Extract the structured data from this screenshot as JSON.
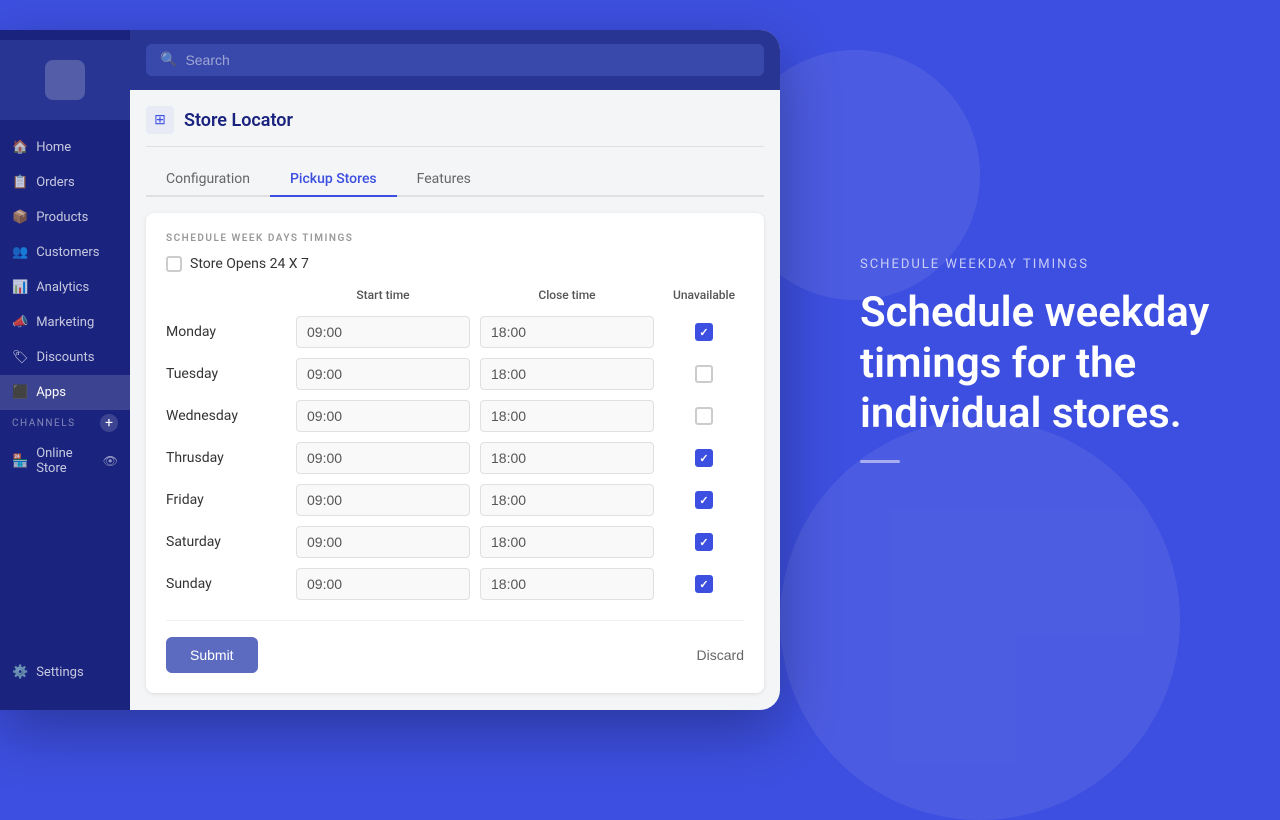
{
  "background": {
    "color": "#3d4fe0"
  },
  "right_panel": {
    "subtitle": "SCHEDULE WEEKDAY TIMINGS",
    "title": "Schedule weekday timings for the individual stores."
  },
  "sidebar": {
    "items": [
      {
        "id": "home",
        "label": "Home"
      },
      {
        "id": "orders",
        "label": "Orders"
      },
      {
        "id": "products",
        "label": "Products"
      },
      {
        "id": "customers",
        "label": "Customers"
      },
      {
        "id": "analytics",
        "label": "Analytics"
      },
      {
        "id": "marketing",
        "label": "Marketing"
      },
      {
        "id": "discounts",
        "label": "Discounts"
      },
      {
        "id": "apps",
        "label": "Apps"
      }
    ],
    "channels_label": "CHANNELS",
    "channels_items": [
      {
        "id": "online-store",
        "label": "Online Store"
      }
    ],
    "settings_label": "Settings",
    "add_icon": "+",
    "eye_icon": "👁"
  },
  "topbar": {
    "search_placeholder": "Search"
  },
  "page": {
    "title": "Store Locator",
    "tabs": [
      {
        "id": "configuration",
        "label": "Configuration"
      },
      {
        "id": "pickup-stores",
        "label": "Pickup Stores",
        "active": true
      },
      {
        "id": "features",
        "label": "Features"
      }
    ]
  },
  "schedule": {
    "section_title": "SCHEDULE WEEK DAYS TIMINGS",
    "store_24x7_label": "Store Opens 24 X 7",
    "store_24x7_checked": false,
    "columns": {
      "day": "",
      "start_time": "Start time",
      "close_time": "Close time",
      "unavailable": "Unavailable"
    },
    "rows": [
      {
        "day": "Monday",
        "start": "09:00",
        "close": "18:00",
        "unavailable": true
      },
      {
        "day": "Tuesday",
        "start": "09:00",
        "close": "18:00",
        "unavailable": false
      },
      {
        "day": "Wednesday",
        "start": "09:00",
        "close": "18:00",
        "unavailable": false
      },
      {
        "day": "Thrusday",
        "start": "09:00",
        "close": "18:00",
        "unavailable": true
      },
      {
        "day": "Friday",
        "start": "09:00",
        "close": "18:00",
        "unavailable": true
      },
      {
        "day": "Saturday",
        "start": "09:00",
        "close": "18:00",
        "unavailable": true
      },
      {
        "day": "Sunday",
        "start": "09:00",
        "close": "18:00",
        "unavailable": true
      }
    ]
  },
  "actions": {
    "submit_label": "Submit",
    "discard_label": "Discard"
  }
}
